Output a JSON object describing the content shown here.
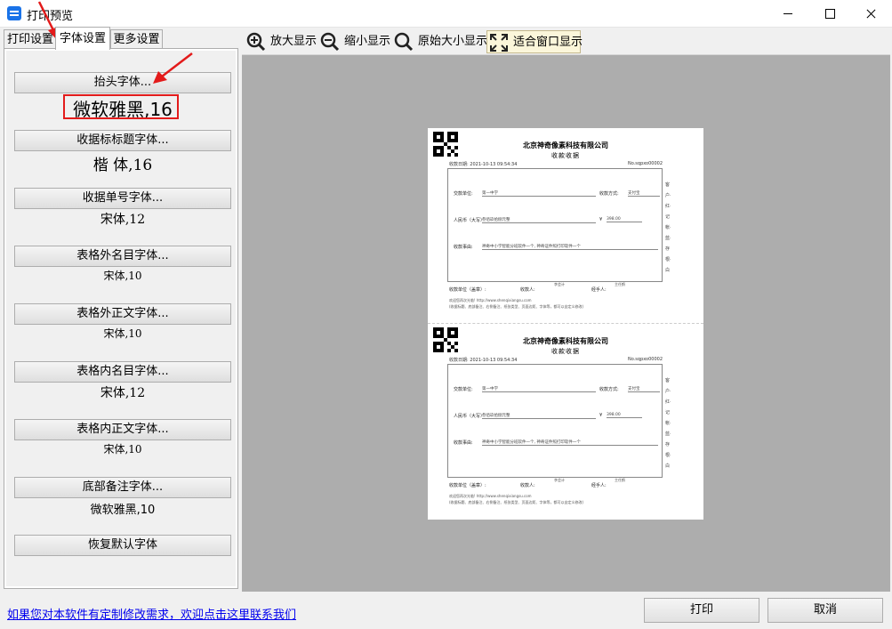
{
  "window": {
    "title": "打印预览"
  },
  "tabs": [
    {
      "label": "打印设置"
    },
    {
      "label": "字体设置"
    },
    {
      "label": "更多设置"
    }
  ],
  "font_settings": [
    {
      "button": "抬头字体...",
      "value": "微软雅黑,16"
    },
    {
      "button": "收据标标题字体...",
      "value": "楷 体,16"
    },
    {
      "button": "收据单号字体...",
      "value": "宋体,12"
    },
    {
      "button": "表格外名目字体...",
      "value": "宋体,10"
    },
    {
      "button": "表格外正文字体...",
      "value": "宋体,10"
    },
    {
      "button": "表格内名目字体...",
      "value": "宋体,12"
    },
    {
      "button": "表格内正文字体...",
      "value": "宋体,10"
    },
    {
      "button": "底部备注字体...",
      "value": "微软雅黑,10"
    }
  ],
  "restore_button": "恢复默认字体",
  "toolbar": {
    "zoom_in": "放大显示",
    "zoom_out": "缩小显示",
    "actual_size": "原始大小显示",
    "fit_window": "适合窗口显示"
  },
  "receipt": {
    "company": "北京神奇像素科技有限公司",
    "title": "收款收据",
    "date": "收款日期: 2021-10-13 09:54:34",
    "number": "No.sqpxo00002",
    "payer_label": "交款单位:",
    "payer_value": "第一中学",
    "method_label": "收款方式:",
    "method_value": "支付宝",
    "rmb_label": "人民币（大写）",
    "rmb_value": "叁佰玖拾捌元整",
    "amount_symbol": "¥",
    "amount_value": "398.00",
    "reason_label": "收款事由:",
    "reason_value": "神奇中小学智能分班软件一个, 神奇证件照打印软件一个",
    "side_text": "客户·红·记帐·蓝·存根·白",
    "accountant": "李会计",
    "director": "主任鹤",
    "unit_seal": "收款单位（盖章）:",
    "receiver": "收款人:",
    "handler": "经手人:",
    "note1": "欢迎您再次光临! http://www.shenqixiangsu.com",
    "note2": "(收据标题、底部备注、右侧备注、纸张类型、页面边距、字体等，都可以自定义修改)"
  },
  "bottom": {
    "link": "如果您对本软件有定制修改需求，欢迎点击这里联系我们",
    "print": "打印",
    "cancel": "取消"
  },
  "colors": {
    "highlight": "#e31b1b",
    "link": "#0000ee",
    "preview_bg": "#adadad"
  }
}
